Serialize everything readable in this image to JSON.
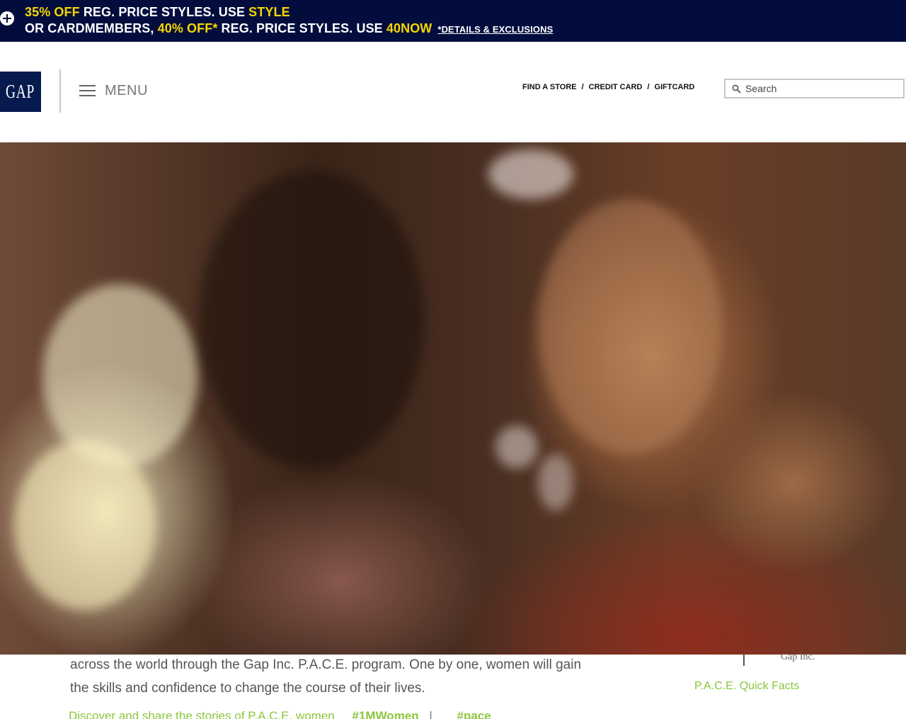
{
  "promo": {
    "line1_a": "35% OFF",
    "line1_b": " REG. PRICE STYLES. USE ",
    "line1_code": "STYLE",
    "line2_a": "OR CARDMEMBERS, ",
    "line2_hl": "40% OFF*",
    "line2_b": " REG. PRICE STYLES. USE ",
    "line2_code": "40NOW",
    "details": "*DETAILS & EXCLUSIONS",
    "icon": "plus-circle-icon",
    "bg_color": "#020d3e",
    "highlight_color": "#f7d600"
  },
  "header": {
    "logo": "GAP",
    "menu_label": "MENU",
    "links": [
      "FIND A STORE",
      "CREDIT CARD",
      "GIFTCARD"
    ],
    "separator": "/",
    "search_placeholder": "Search",
    "logo_color": "#071a4e"
  },
  "content": {
    "body_text": "across the world through the Gap Inc. P.A.C.E. program. One by one, women will gain the skills and confidence to change the course of their lives.",
    "discover_text": "Discover and share the stories of P.A.C.E. women",
    "hashtag1": "#1MWomen",
    "hashtag_sep": "|",
    "hashtag2": "#pace",
    "side_label": "Gap Inc.",
    "quick_facts_link": "P.A.C.E. Quick Facts",
    "accent_color": "#8cc63f"
  }
}
